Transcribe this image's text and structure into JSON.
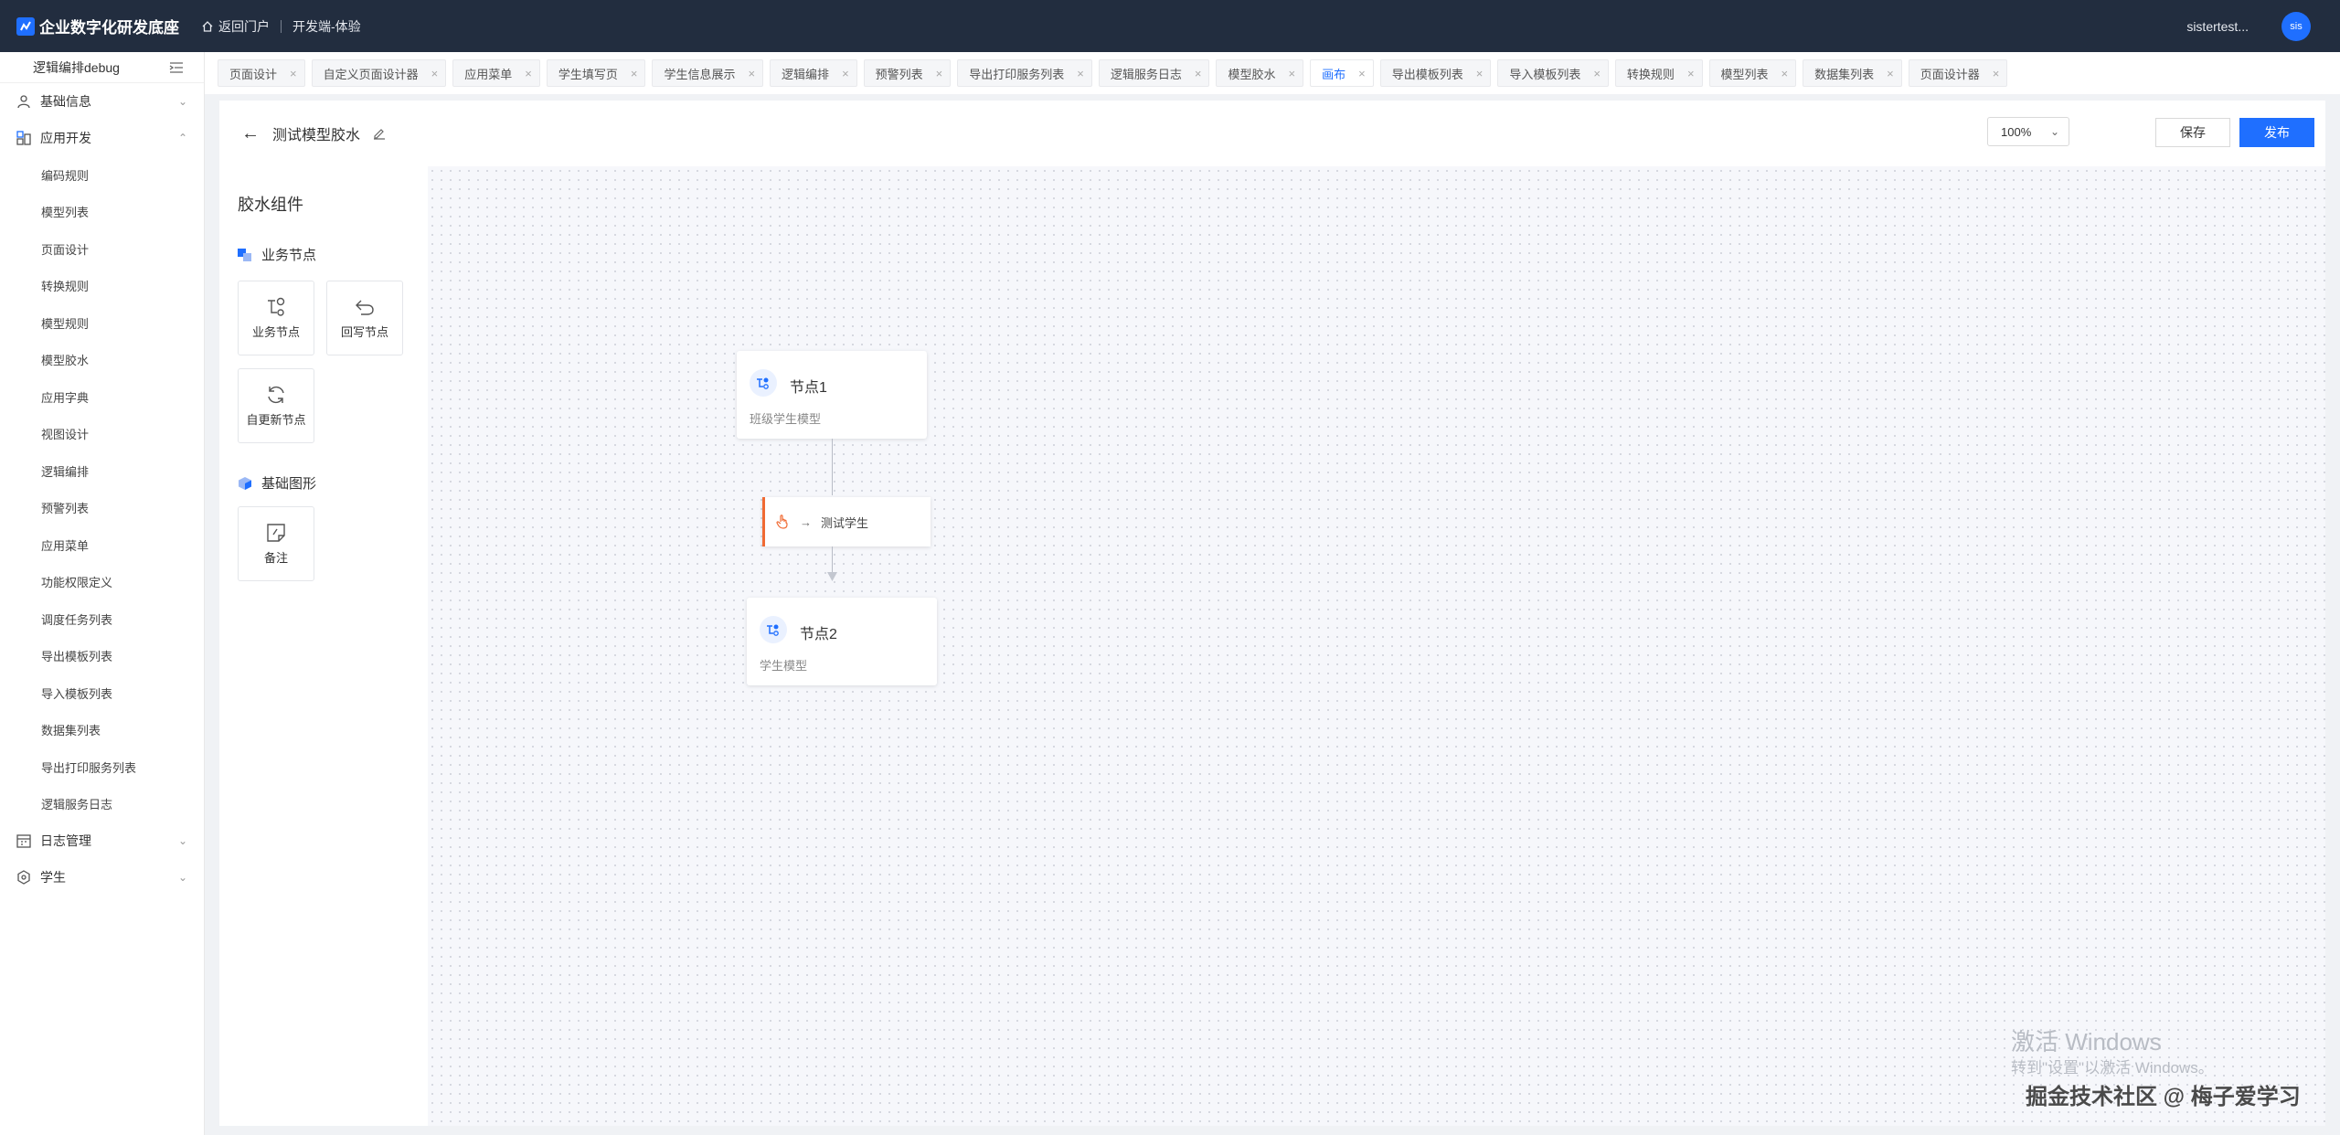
{
  "header": {
    "app_title": "企业数字化研发底座",
    "home_label": "返回门户",
    "env_label": "开发端-体验",
    "username": "sistertest...",
    "avatar_text": "sis"
  },
  "sidebar": {
    "title": "逻辑编排debug",
    "groups": [
      {
        "label": "基础信息",
        "expanded": false
      },
      {
        "label": "应用开发",
        "expanded": true,
        "items": [
          "编码规则",
          "模型列表",
          "页面设计",
          "转换规则",
          "模型规则",
          "模型胶水",
          "应用字典",
          "视图设计",
          "逻辑编排",
          "预警列表",
          "应用菜单",
          "功能权限定义",
          "调度任务列表",
          "导出模板列表",
          "导入模板列表",
          "数据集列表",
          "导出打印服务列表",
          "逻辑服务日志"
        ]
      },
      {
        "label": "日志管理",
        "expanded": false
      },
      {
        "label": "学生",
        "expanded": false
      }
    ]
  },
  "tabs": [
    "页面设计",
    "自定义页面设计器",
    "应用菜单",
    "学生填写页",
    "学生信息展示",
    "逻辑编排",
    "预警列表",
    "导出打印服务列表",
    "逻辑服务日志",
    "模型胶水",
    "画布",
    "导出模板列表",
    "导入模板列表",
    "转换规则",
    "模型列表",
    "数据集列表",
    "页面设计器"
  ],
  "active_tab": "画布",
  "editor": {
    "title": "测试模型胶水",
    "zoom": "100%",
    "save_label": "保存",
    "publish_label": "发布"
  },
  "palette": {
    "title": "胶水组件",
    "section_business": "业务节点",
    "business_cards": [
      "业务节点",
      "回写节点",
      "自更新节点"
    ],
    "section_basic": "基础图形",
    "basic_cards": [
      "备注"
    ]
  },
  "canvas": {
    "node1": {
      "name": "节点1",
      "model": "班级学生模型"
    },
    "edge": {
      "label": "测试学生",
      "arrow": "→"
    },
    "node2": {
      "name": "节点2",
      "model": "学生模型"
    }
  },
  "watermark": {
    "line1": "激活 Windows",
    "line2": "转到\"设置\"以激活 Windows。",
    "line3": "掘金技术社区 @ 梅子爱学习"
  },
  "colors": {
    "header_bg": "#222d3f",
    "primary": "#1f6fff",
    "edge_accent": "#f06a33"
  }
}
